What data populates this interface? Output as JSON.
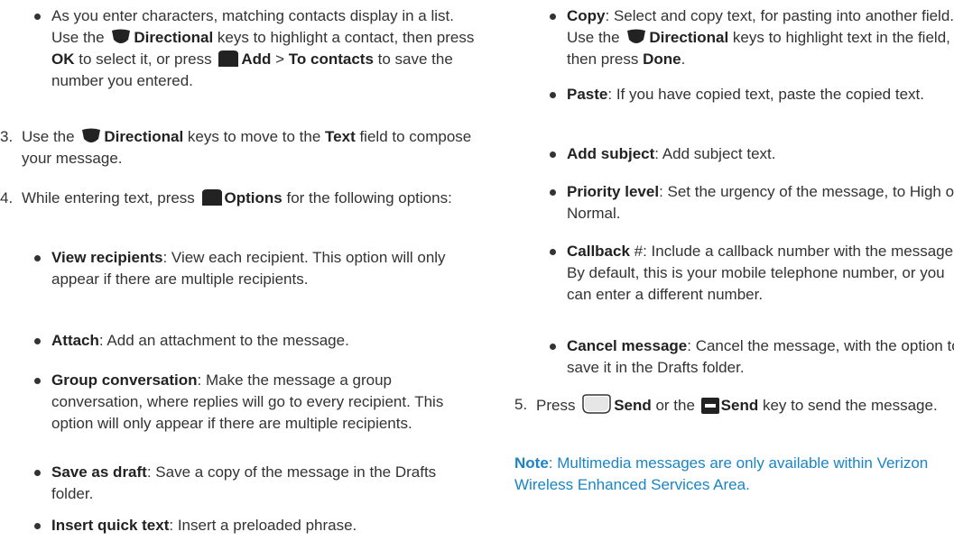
{
  "left": {
    "b_contacts": {
      "t1": "As you enter characters, matching contacts display in a list. Use the ",
      "k1": "Directional",
      "t2": " keys to highlight a contact, then press ",
      "k2": "OK",
      "t3": " to select it, or press ",
      "k3": "Add",
      "t4": " > ",
      "k4": "To contacts",
      "t5": " to save the number you entered."
    },
    "step3": {
      "num": "3.",
      "t1": "Use the ",
      "k1": "Directional",
      "t2": " keys to move to the ",
      "k2": "Text",
      "t3": " field to compose your message."
    },
    "step4": {
      "num": "4.",
      "t1": "While entering text, press ",
      "k1": "Options",
      "t2": " for the following options:"
    },
    "options": [
      {
        "label": "View recipients",
        "text": ": View each recipient. This option will only appear if there are multiple recipients."
      },
      {
        "label": "Attach",
        "text": ": Add an attachment to the message."
      },
      {
        "label": "Group conversation",
        "text": ": Make the message a group conversation, where replies will go to every recipient. This option will only appear if there are multiple recipients."
      },
      {
        "label": "Save as draft",
        "text": ": Save a copy of the message in the Drafts folder."
      },
      {
        "label": "Insert quick text",
        "text": ": Insert a preloaded phrase."
      }
    ]
  },
  "right": {
    "copy": {
      "label": "Copy",
      "t1": ": Select and copy text, for pasting into another field. Use the ",
      "k1": "Directional",
      "t2": " keys to highlight text in the field, then press ",
      "k2": "Done",
      "t3": "."
    },
    "options": [
      {
        "label": "Paste",
        "text": ": If you have copied text, paste the copied text."
      },
      {
        "label": "Add subject",
        "text": ": Add subject text."
      },
      {
        "label": "Priority level",
        "text": ": Set the urgency of the message, to High or Normal."
      },
      {
        "label": "Callback",
        "text": " #: Include a callback number with the message. By default, this is your mobile telephone number, or you can enter a different number."
      },
      {
        "label": "Cancel message",
        "text": ": Cancel the message, with the option to save it in the Drafts folder."
      }
    ],
    "step5": {
      "num": "5.",
      "t1": "Press ",
      "k1": "Send",
      "t2": " or the ",
      "k2": "Send",
      "t3": " key to send the message."
    },
    "note": {
      "label": "Note",
      "text": ": Multimedia messages are only available within Verizon Wireless Enhanced Services Area."
    }
  },
  "icons": {
    "directional": "directional-key-icon",
    "softkey": "soft-key-icon",
    "send_soft": "send-soft-key-icon",
    "send_hw": "send-key-icon"
  },
  "colors": {
    "text": "#333333",
    "note": "#1a84c6",
    "icon": "#222222"
  }
}
